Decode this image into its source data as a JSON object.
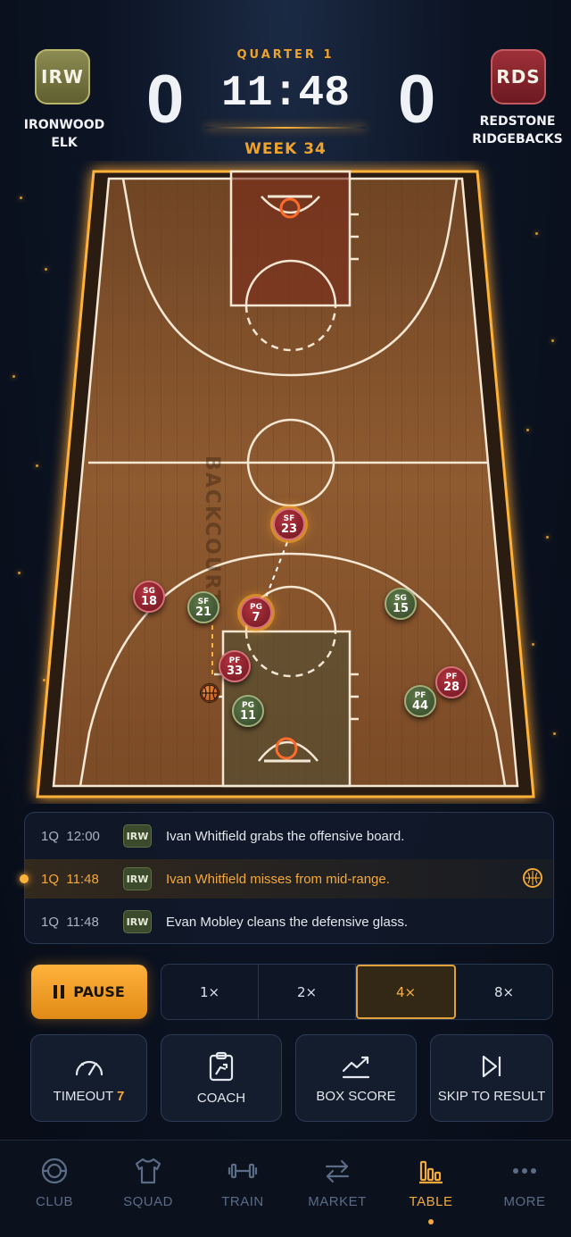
{
  "scoreboard": {
    "home": {
      "abbr": "IRW",
      "name": "IRONWOOD ELK",
      "score": "0",
      "color": "#7a7a45"
    },
    "away": {
      "abbr": "RDS",
      "name_line1": "REDSTONE",
      "name_line2": "RIDGEBACKS",
      "score": "0",
      "color": "#8e2530"
    },
    "quarter": "QUARTER 1",
    "clock": "11:48",
    "week": "WEEK 34"
  },
  "court": {
    "label": "BACKCOURT",
    "players": [
      {
        "team": "away",
        "pos": "SF",
        "num": "23"
      },
      {
        "team": "away",
        "pos": "SG",
        "num": "18"
      },
      {
        "team": "home",
        "pos": "SF",
        "num": "21"
      },
      {
        "team": "away",
        "pos": "PG",
        "num": "7"
      },
      {
        "team": "home",
        "pos": "SG",
        "num": "15"
      },
      {
        "team": "away",
        "pos": "PF",
        "num": "33"
      },
      {
        "team": "away",
        "pos": "PF",
        "num": "28"
      },
      {
        "team": "home",
        "pos": "PF",
        "num": "44"
      },
      {
        "team": "home",
        "pos": "PG",
        "num": "11"
      }
    ]
  },
  "feed": [
    {
      "quarter": "1Q",
      "time": "12:00",
      "team": "IRW",
      "text": "Ivan Whitfield grabs the offensive board."
    },
    {
      "quarter": "1Q",
      "time": "11:48",
      "team": "IRW",
      "text": "Ivan Whitfield misses from mid-range."
    },
    {
      "quarter": "1Q",
      "time": "11:48",
      "team": "IRW",
      "text": "Evan Mobley cleans the defensive glass."
    }
  ],
  "controls": {
    "pause_label": "PAUSE",
    "speeds": [
      "1×",
      "2×",
      "4×",
      "8×"
    ],
    "selected_speed": "4×",
    "timeout_label": "TIMEOUT",
    "timeout_count": "7",
    "coach_label": "COACH",
    "box_score_label": "BOX SCORE",
    "skip_label": "SKIP TO RESULT"
  },
  "nav": {
    "items": [
      "CLUB",
      "SQUAD",
      "TRAIN",
      "MARKET",
      "TABLE",
      "MORE"
    ],
    "active": "TABLE"
  },
  "colors": {
    "accent": "#f4a93a",
    "background": "#0c1424"
  }
}
